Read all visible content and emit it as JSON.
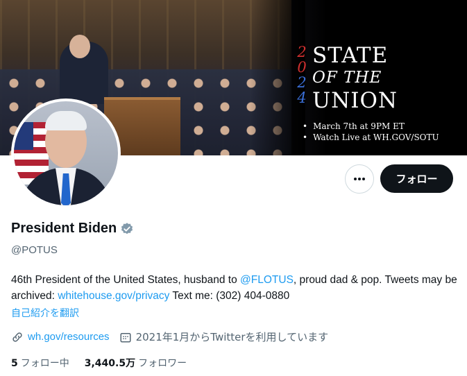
{
  "banner": {
    "year_digits": [
      "2",
      "0",
      "2",
      "4"
    ],
    "year_colors": [
      "#d03030",
      "#d03030",
      "#3b6fd8",
      "#3b6fd8"
    ],
    "title_line1": "STATE",
    "title_line2": "OF THE",
    "title_line3": "UNION",
    "detail_line1": "March 7th at 9PM ET",
    "detail_line2": "Watch Live at WH.GOV/SOTU"
  },
  "actions": {
    "more_icon": "more-horizontal-icon",
    "follow_label": "フォロー"
  },
  "profile": {
    "name": "President Biden",
    "verified_icon": "verified-badge-icon",
    "handle": "@POTUS",
    "bio_part1": "46th President of the United States, husband to ",
    "bio_mention": "@FLOTUS",
    "bio_part2": ", proud dad & pop. Tweets may be archived: ",
    "bio_link": "whitehouse.gov/privacy",
    "bio_part3": " Text me: (302) 404-0880",
    "translate_label": "自己紹介を翻訳",
    "website": "wh.gov/resources",
    "joined": "2021年1月からTwitterを利用しています",
    "following_count": "5",
    "following_label": "フォロー中",
    "followers_count": "3,440.5万",
    "followers_label": "フォロワー"
  },
  "colors": {
    "accent": "#1d9bf0",
    "text": "#0f1419",
    "muted": "#536471",
    "verified": "#829aab"
  }
}
